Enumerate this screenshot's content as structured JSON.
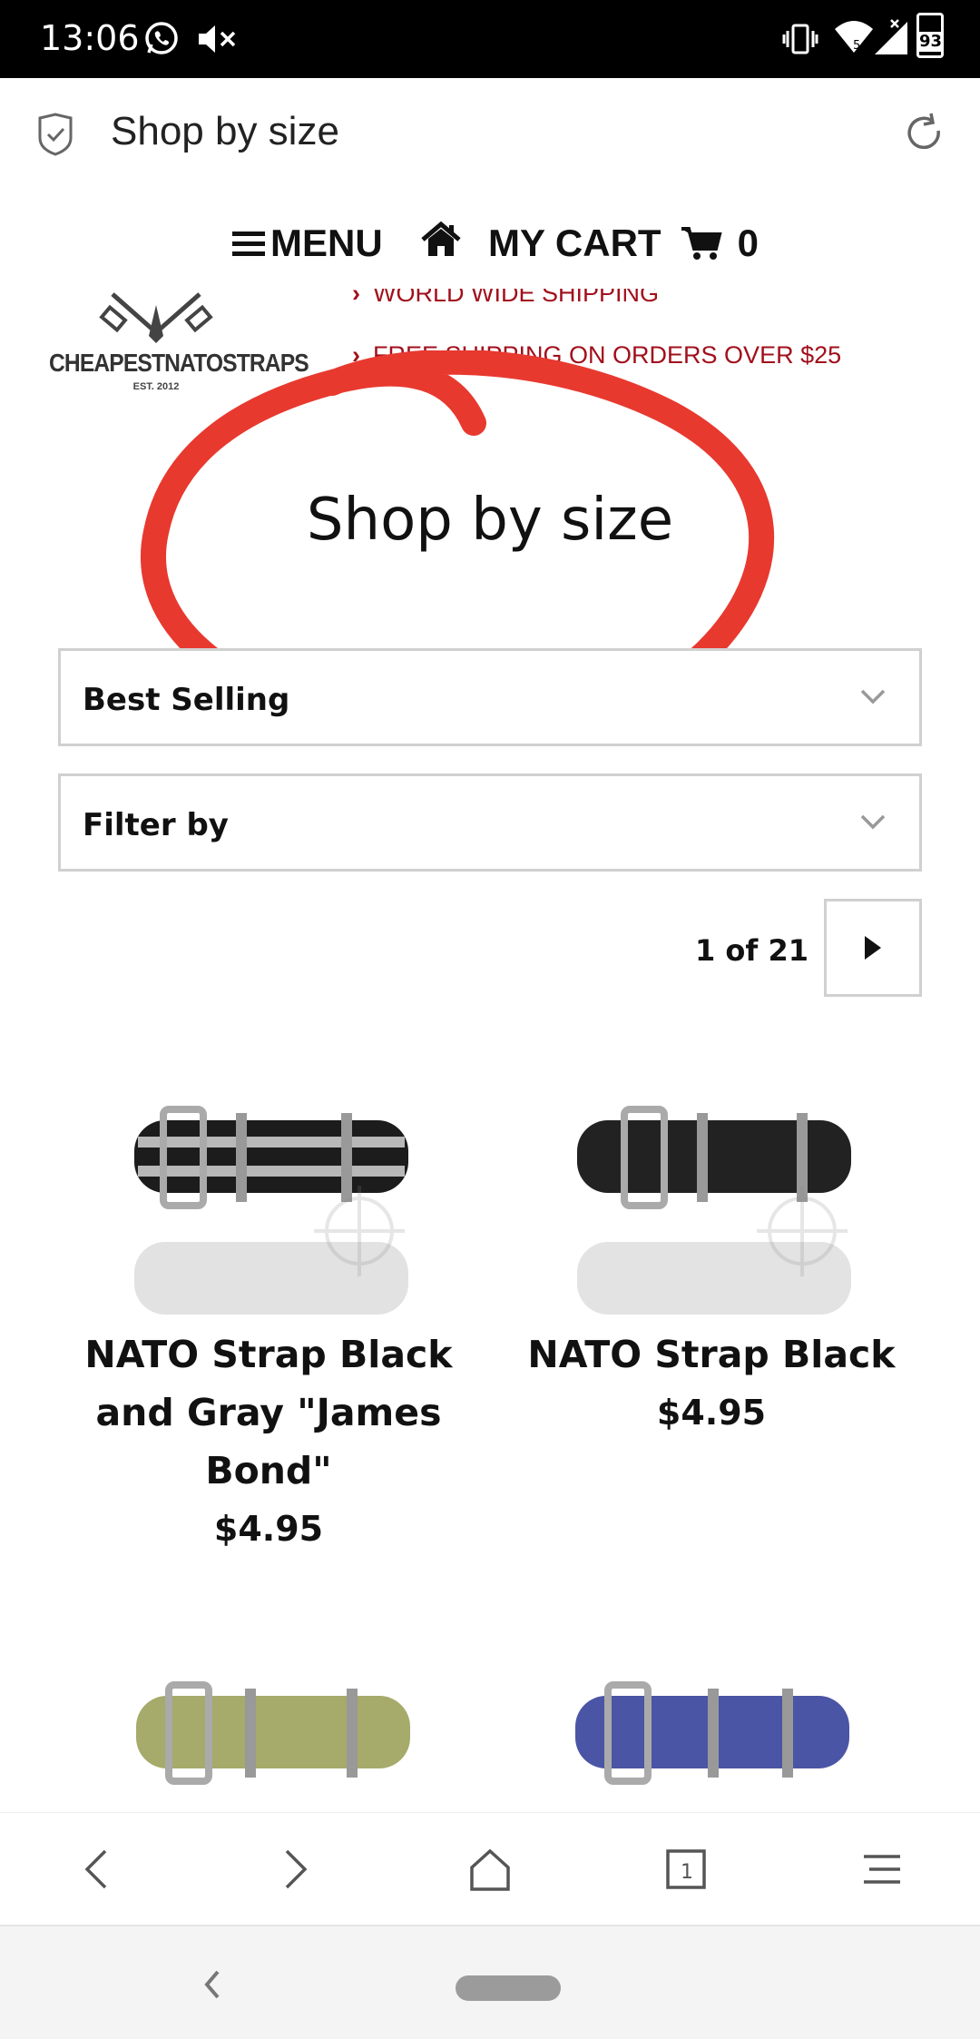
{
  "status_bar": {
    "time": "13:06",
    "battery": "93",
    "icons": [
      "whatsapp-icon",
      "mute-icon",
      "vibrate-icon",
      "wifi-icon",
      "signal-icon",
      "battery-icon"
    ]
  },
  "browser": {
    "page_title": "Shop by size",
    "icons": [
      "shield-check-icon",
      "refresh-icon"
    ]
  },
  "nav": {
    "menu_label": "MENU",
    "cart_label": "MY CART",
    "cart_count": "0"
  },
  "logo": {
    "name": "CHEAPESTNATOSTRAPS",
    "est": "EST. 2012"
  },
  "promos": [
    "WORLD WIDE SHIPPING",
    "FREE SHIPPING ON ORDERS OVER $25"
  ],
  "collection": {
    "title": "Shop by size"
  },
  "sort": {
    "selected": "Best Selling"
  },
  "filter": {
    "selected": "Filter by"
  },
  "pagination": {
    "text": "1 of 21"
  },
  "products": [
    {
      "name": "NATO Strap Black and Gray \"James Bond\"",
      "price": "$4.95",
      "colors": [
        "#1c1c1c",
        "#b8b8b8"
      ]
    },
    {
      "name": "NATO Strap Black",
      "price": "$4.95",
      "colors": [
        "#222222"
      ]
    },
    {
      "name": "",
      "price": "",
      "colors": [
        "#a6aa6a"
      ]
    },
    {
      "name": "",
      "price": "",
      "colors": [
        "#4b55a5"
      ]
    }
  ],
  "colors": {
    "annotation": "#e8392f",
    "promo_text": "#a1101c",
    "border": "#d0d0d0"
  }
}
